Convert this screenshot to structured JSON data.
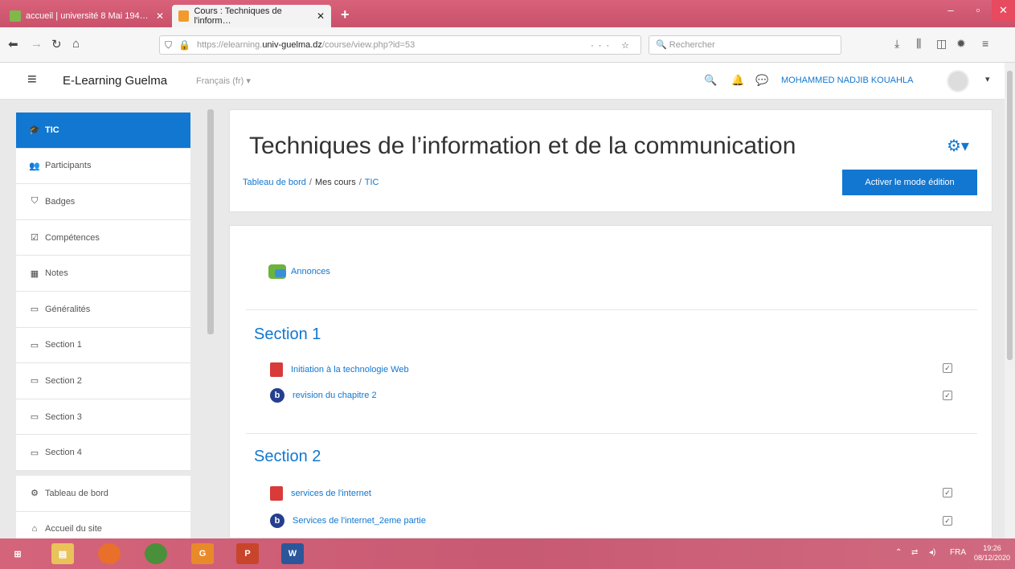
{
  "browser": {
    "tabs": [
      {
        "label": "accueil | université 8 Mai 194…",
        "active": false
      },
      {
        "label": "Cours : Techniques de l'inform…",
        "active": true
      }
    ],
    "url_prefix": "https://elearning.",
    "url_domain": "univ-guelma.dz",
    "url_path": "/course/view.php?id=53",
    "search_placeholder": "Rechercher"
  },
  "navbar": {
    "site_name": "E-Learning Guelma",
    "language": "Français (fr) ▾",
    "user_name": "MOHAMMED NADJIB KOUAHLA"
  },
  "drawer": {
    "items": [
      {
        "label": "TIC",
        "icon": "graduation-cap-icon",
        "active": true
      },
      {
        "label": "Participants",
        "icon": "users-icon"
      },
      {
        "label": "Badges",
        "icon": "shield-icon"
      },
      {
        "label": "Compétences",
        "icon": "checklist-icon"
      },
      {
        "label": "Notes",
        "icon": "table-icon"
      },
      {
        "label": "Généralités",
        "icon": "folder-icon"
      },
      {
        "label": "Section 1",
        "icon": "folder-icon"
      },
      {
        "label": "Section 2",
        "icon": "folder-icon"
      },
      {
        "label": "Section 3",
        "icon": "folder-icon"
      },
      {
        "label": "Section 4",
        "icon": "folder-icon"
      },
      {
        "label": "Tableau de bord",
        "icon": "dashboard-icon"
      },
      {
        "label": "Accueil du site",
        "icon": "home-icon"
      }
    ]
  },
  "header": {
    "title": "Techniques de l’information et de la communication",
    "breadcrumb": [
      "Tableau de bord",
      "Mes cours",
      "TIC"
    ],
    "edit_button": "Activer le mode édition"
  },
  "content": {
    "announcements": "Annonces",
    "sections": [
      {
        "title": "Section 1",
        "activities": [
          {
            "label": "Initiation à la technologie Web",
            "type": "pdf"
          },
          {
            "label": "revision du chapitre 2",
            "type": "bigbluebutton"
          }
        ]
      },
      {
        "title": "Section 2",
        "activities": [
          {
            "label": "services de l'internet",
            "type": "pdf"
          },
          {
            "label": "Services de l'internet_2eme partie",
            "type": "bigbluebutton"
          }
        ]
      }
    ]
  },
  "taskbar": {
    "apps": [
      "windows-start",
      "file-explorer",
      "firefox",
      "chrome",
      "app-orange",
      "powerpoint",
      "word"
    ],
    "lang": "FRA",
    "time": "19:26",
    "date": "08/12/2020"
  },
  "colors": {
    "accent": "#1177d1",
    "browser_bar": "#d4647a"
  }
}
